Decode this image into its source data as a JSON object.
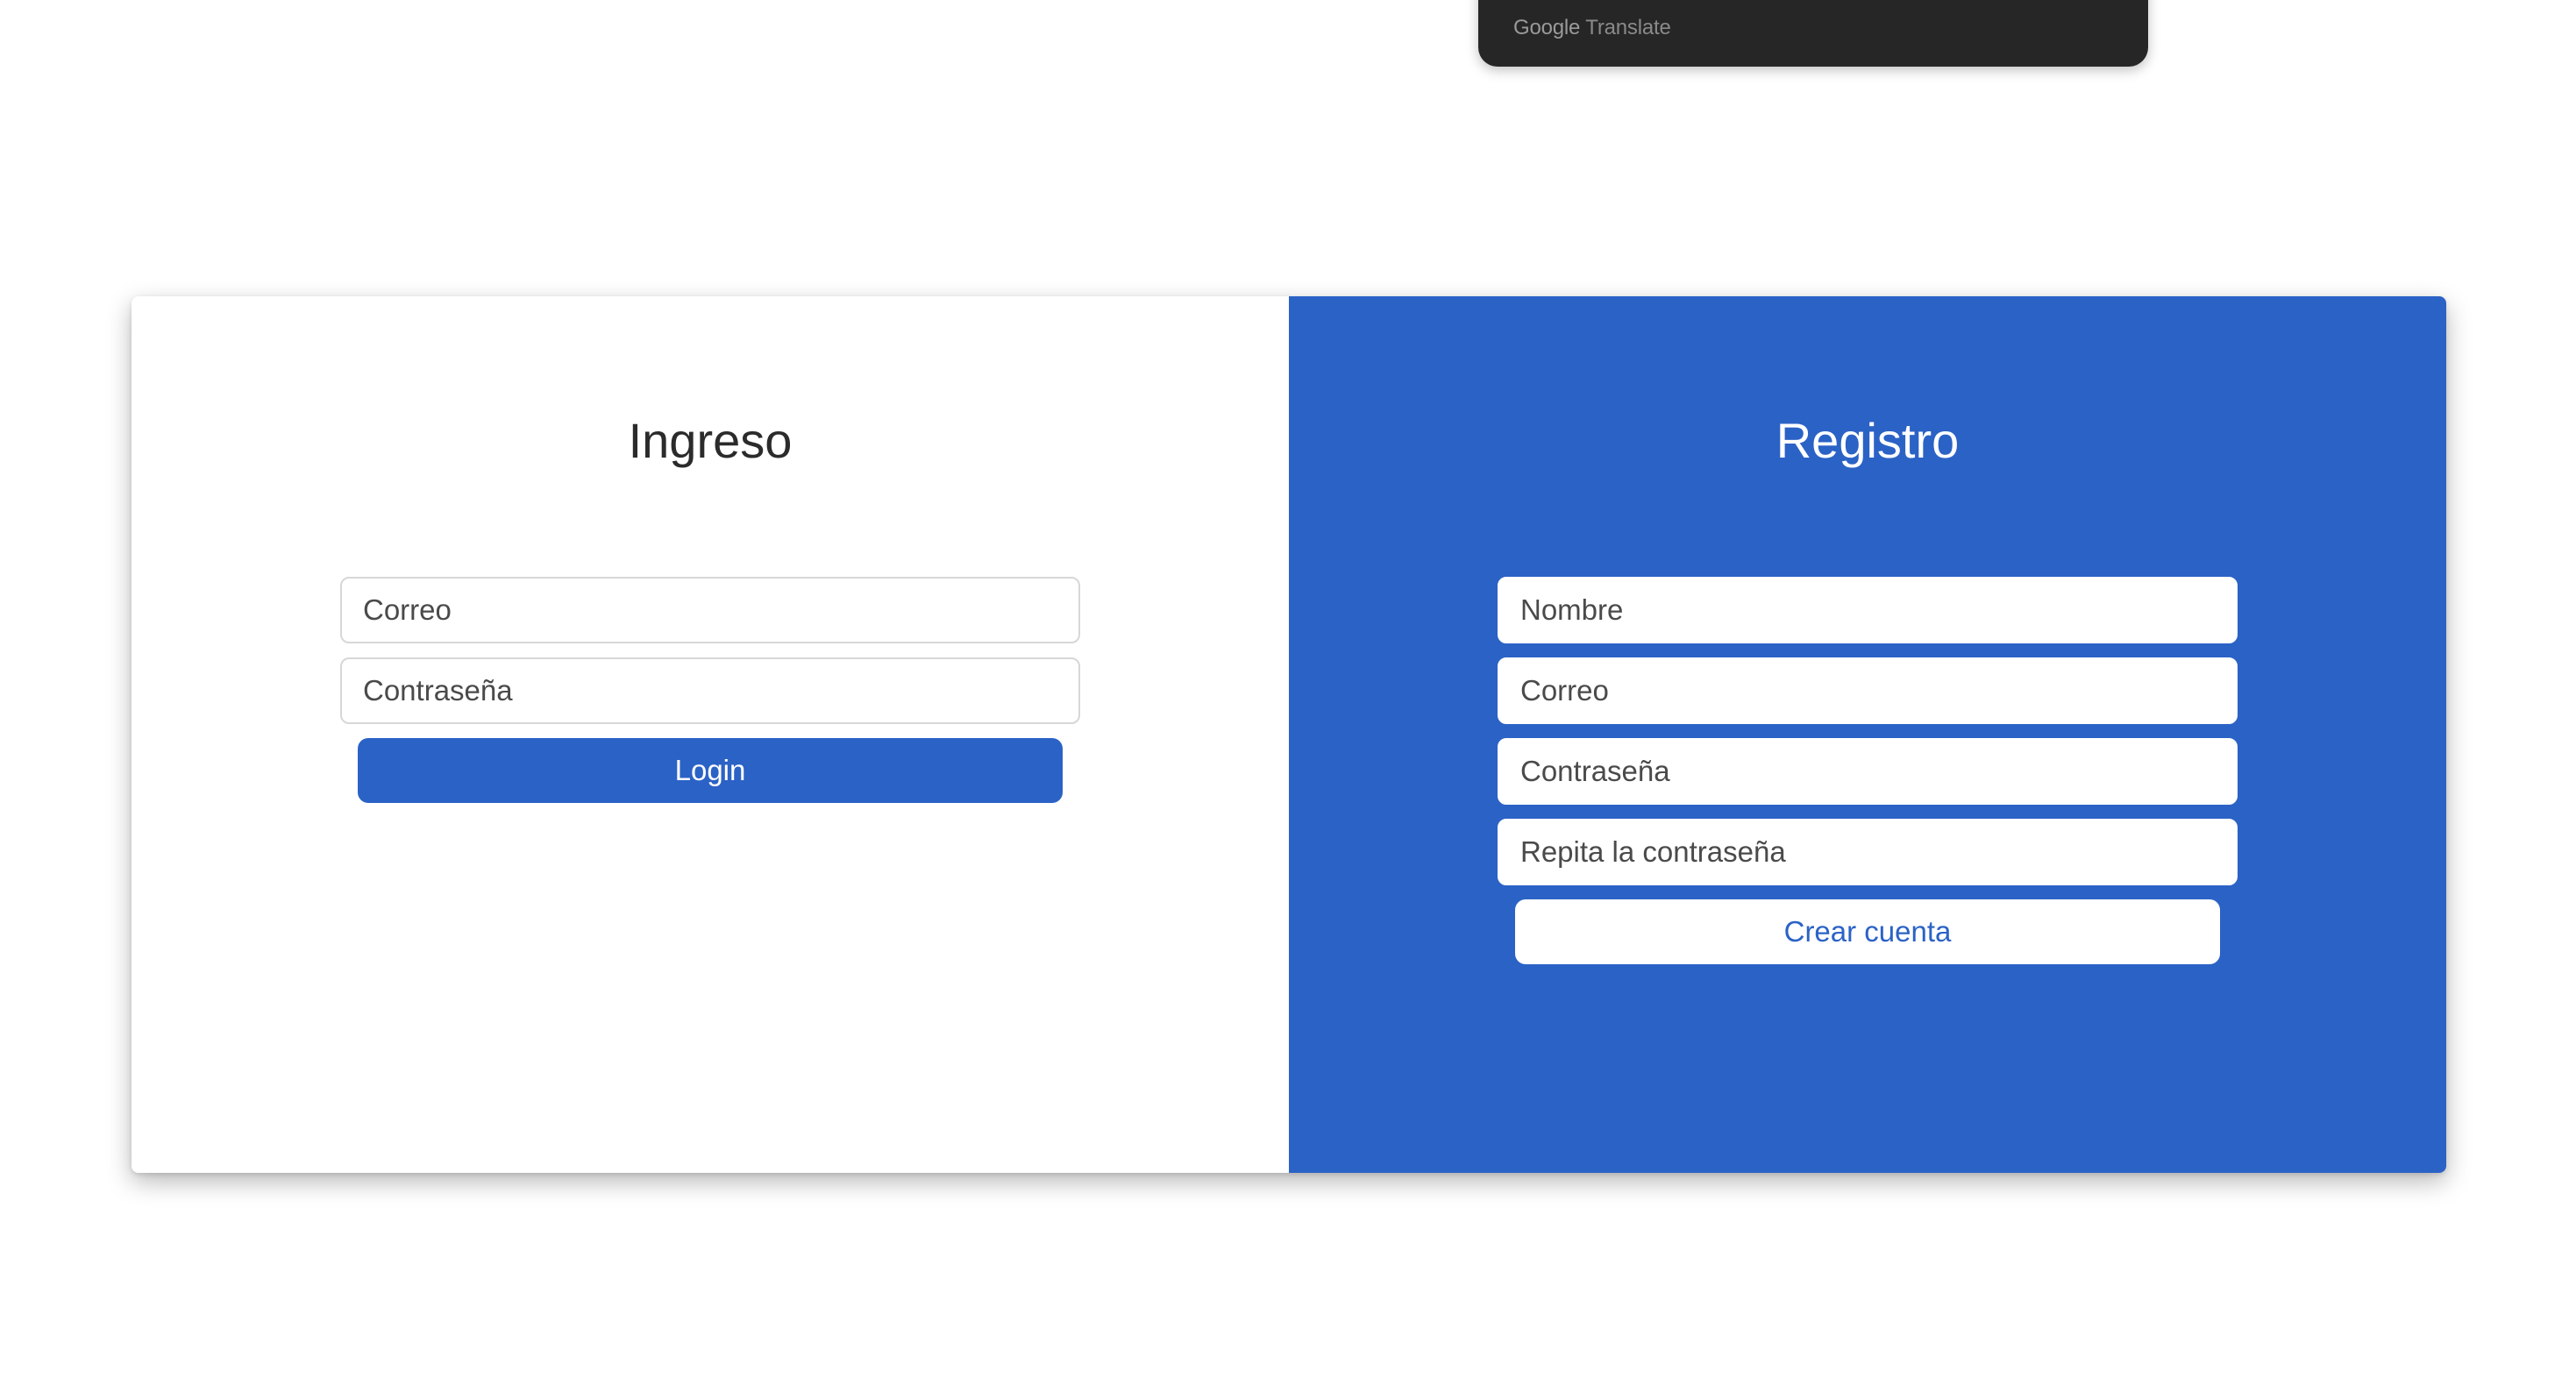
{
  "translate_popup": {
    "brand_google": "Google",
    "brand_translate": "Translate"
  },
  "login": {
    "title": "Ingreso",
    "email_placeholder": "Correo",
    "password_placeholder": "Contraseña",
    "submit_label": "Login"
  },
  "register": {
    "title": "Registro",
    "name_placeholder": "Nombre",
    "email_placeholder": "Correo",
    "password_placeholder": "Contraseña",
    "repeat_password_placeholder": "Repita la contraseña",
    "submit_label": "Crear cuenta"
  },
  "colors": {
    "accent": "#2b62c6",
    "popup_bg": "#262626"
  }
}
